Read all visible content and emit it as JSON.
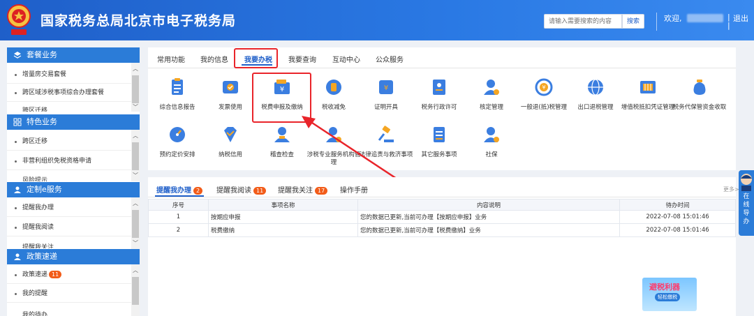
{
  "header": {
    "title": "国家税务总局北京市电子税务局",
    "search_placeholder": "请输入需要搜索的内容",
    "search_button": "搜索",
    "welcome": "欢迎,",
    "logout": "退出",
    "sep": "|"
  },
  "sidebar": {
    "sections": [
      {
        "title": "套餐业务",
        "items": [
          "增量房交易套餐",
          "跨区域涉税事项综合办理套餐",
          "跨区迁移"
        ]
      },
      {
        "title": "特色业务",
        "items": [
          "跨区迁移",
          "非营利组织免税资格申请",
          "风险提示"
        ]
      },
      {
        "title": "定制e服务",
        "items": [
          "提醒我办理",
          "提醒我阅读",
          "提醒我关注"
        ]
      },
      {
        "title": "政策速递",
        "items": [
          "政策速递",
          "我的提醒",
          "我的待办"
        ],
        "badge": "11"
      }
    ]
  },
  "tabs": [
    "常用功能",
    "我的信息",
    "我要办税",
    "我要查询",
    "互动中心",
    "公众服务"
  ],
  "functions": {
    "row1": [
      "综合信息报告",
      "发票使用",
      "税费申报及缴纳",
      "税收减免",
      "证明开具",
      "税务行政许可",
      "核定管理",
      "一般退(抵)税管理",
      "出口退税管理",
      "增值税抵扣凭证管理",
      "税务代保管资金收取"
    ],
    "row2": [
      "预约定价安排",
      "纳税信用",
      "稽查检查",
      "涉税专业服务机构管理",
      "法律追责与救济事项",
      "其它服务事项",
      "社保"
    ]
  },
  "reminders": {
    "tabs": [
      {
        "label": "提醒我办理",
        "badge": "2"
      },
      {
        "label": "提醒我阅读",
        "badge": "11"
      },
      {
        "label": "提醒我关注",
        "badge": "17"
      },
      {
        "label": "操作手册",
        "badge": ""
      }
    ],
    "more": "更多>",
    "columns": [
      "序号",
      "事项名称",
      "内容说明",
      "待办时间"
    ],
    "rows": [
      {
        "no": "1",
        "name": "按期应申报",
        "desc": "您的数据已更新,当前可办理【按期应申报】业务",
        "time": "2022-07-08 15:01:46"
      },
      {
        "no": "2",
        "name": "税费缴纳",
        "desc": "您的数据已更新,当前可办理【税费缴纳】业务",
        "time": "2022-07-08 15:01:46"
      }
    ]
  },
  "float": {
    "label": "在线导办"
  },
  "promo": {
    "title": "避税利器",
    "sub": "轻松缴税"
  },
  "colors": {
    "brand": "#1f5fc9",
    "sidebar_head": "#2b7cd8",
    "highlight": "#e9242a",
    "badge": "#f25c19"
  }
}
